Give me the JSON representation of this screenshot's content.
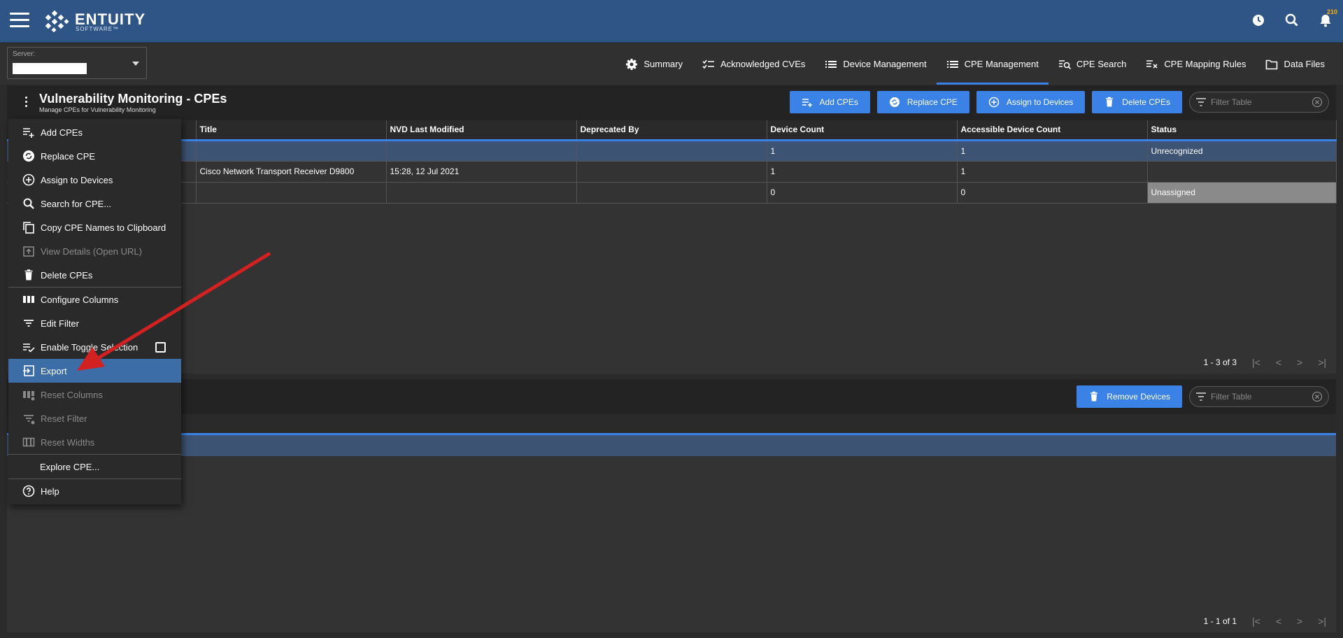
{
  "header": {
    "brand": "ENTUITY",
    "brand_sub": "SOFTWARE™",
    "notifications_count": "210"
  },
  "server": {
    "label": "Server:",
    "value": ""
  },
  "nav": {
    "tabs": [
      {
        "label": "Summary",
        "icon": "gear-icon"
      },
      {
        "label": "Acknowledged CVEs",
        "icon": "checklist-icon"
      },
      {
        "label": "Device Management",
        "icon": "list-icon"
      },
      {
        "label": "CPE Management",
        "icon": "list-icon",
        "active": true
      },
      {
        "label": "CPE Search",
        "icon": "search-list-icon"
      },
      {
        "label": "CPE Mapping Rules",
        "icon": "mapping-list-icon"
      },
      {
        "label": "Data Files",
        "icon": "folder-icon"
      }
    ]
  },
  "panel": {
    "title": "Vulnerability Monitoring - CPEs",
    "subtitle": "Manage CPEs for Vulnerability Monitoring",
    "actions": {
      "add": "Add CPEs",
      "replace": "Replace CPE",
      "assign": "Assign to Devices",
      "delete": "Delete CPEs"
    },
    "filter_placeholder": "Filter Table"
  },
  "table": {
    "columns": [
      "Title",
      "NVD Last Modified",
      "Deprecated By",
      "Device Count",
      "Accessible Device Count",
      "Status"
    ],
    "rows": [
      {
        "title": "",
        "modified": "",
        "deprecated": "",
        "count": "1",
        "accessible": "1",
        "status": "Unrecognized"
      },
      {
        "title": "Cisco Network Transport Receiver D9800",
        "modified": "15:28, 12 Jul 2021",
        "deprecated": "",
        "count": "1",
        "accessible": "1",
        "status": ""
      },
      {
        "title": "",
        "modified": "",
        "deprecated": "",
        "count": "0",
        "accessible": "0",
        "status": "Unassigned"
      }
    ],
    "pager": "1 - 3 of 3"
  },
  "devices_panel": {
    "remove_button": "Remove Devices",
    "filter_placeholder": "Filter Table",
    "pager": "1 - 1 of 1"
  },
  "menu": {
    "items": [
      {
        "label": "Add CPEs",
        "icon": "add-list-icon"
      },
      {
        "label": "Replace CPE",
        "icon": "replace-icon"
      },
      {
        "label": "Assign to Devices",
        "icon": "plus-circle-icon"
      },
      {
        "label": "Search for CPE...",
        "icon": "search-icon"
      },
      {
        "label": "Copy CPE Names to Clipboard",
        "icon": "copy-icon"
      },
      {
        "label": "View Details (Open URL)",
        "icon": "open-url-icon"
      },
      {
        "label": "Delete CPEs",
        "icon": "trash-icon"
      },
      {
        "label": "Configure Columns",
        "icon": "columns-icon"
      },
      {
        "label": "Edit Filter",
        "icon": "filter-icon"
      },
      {
        "label": "Enable Toggle Selection",
        "icon": "toggle-list-icon"
      },
      {
        "label": "Export",
        "icon": "export-icon"
      },
      {
        "label": "Reset Columns",
        "icon": "reset-columns-icon"
      },
      {
        "label": "Reset Filter",
        "icon": "reset-filter-icon"
      },
      {
        "label": "Reset Widths",
        "icon": "reset-widths-icon"
      },
      {
        "label": "Explore CPE...",
        "icon": ""
      },
      {
        "label": "Help",
        "icon": "help-icon"
      }
    ]
  },
  "colors": {
    "header_bg": "#2f5587",
    "accent": "#3b82e6",
    "selected_row": "#3d5373",
    "annotation_arrow": "#d32020"
  }
}
